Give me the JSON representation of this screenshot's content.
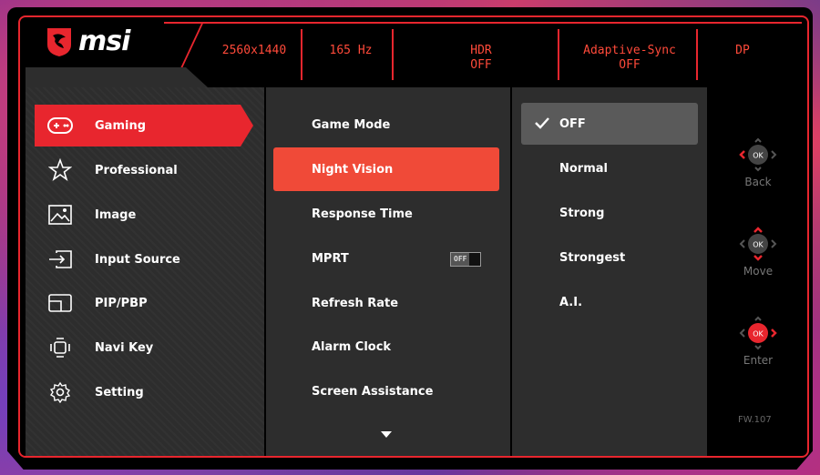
{
  "brand": {
    "name": "msi"
  },
  "status": {
    "resolution": "2560x1440",
    "refresh": "165 Hz",
    "hdr_label": "HDR",
    "hdr_value": "OFF",
    "sync_label": "Adaptive-Sync",
    "sync_value": "OFF",
    "input": "DP"
  },
  "main_menu": [
    {
      "label": "Gaming",
      "icon": "gamepad-icon",
      "active": true
    },
    {
      "label": "Professional",
      "icon": "star-icon"
    },
    {
      "label": "Image",
      "icon": "image-icon"
    },
    {
      "label": "Input Source",
      "icon": "input-source-icon"
    },
    {
      "label": "PIP/PBP",
      "icon": "pip-icon"
    },
    {
      "label": "Navi Key",
      "icon": "navi-key-icon"
    },
    {
      "label": "Setting",
      "icon": "gear-icon"
    }
  ],
  "submenu": [
    {
      "label": "Game Mode"
    },
    {
      "label": "Night Vision",
      "active": true
    },
    {
      "label": "Response Time"
    },
    {
      "label": "MPRT",
      "toggle": "OFF"
    },
    {
      "label": "Refresh Rate"
    },
    {
      "label": "Alarm Clock"
    },
    {
      "label": "Screen Assistance"
    }
  ],
  "options": [
    {
      "label": "OFF",
      "selected": true
    },
    {
      "label": "Normal"
    },
    {
      "label": "Strong"
    },
    {
      "label": "Strongest"
    },
    {
      "label": "A.I."
    }
  ],
  "nav_keys": [
    {
      "label": "Back",
      "icon": "joystick-back-icon"
    },
    {
      "label": "Move",
      "icon": "joystick-move-icon"
    },
    {
      "label": "Enter",
      "icon": "joystick-enter-icon"
    }
  ],
  "nav_ok": "OK",
  "firmware": "FW.107",
  "colors": {
    "accent": "#e8262e",
    "highlight": "#f04a38",
    "panel": "#2d2d2d",
    "selected": "#5a5a5a"
  }
}
